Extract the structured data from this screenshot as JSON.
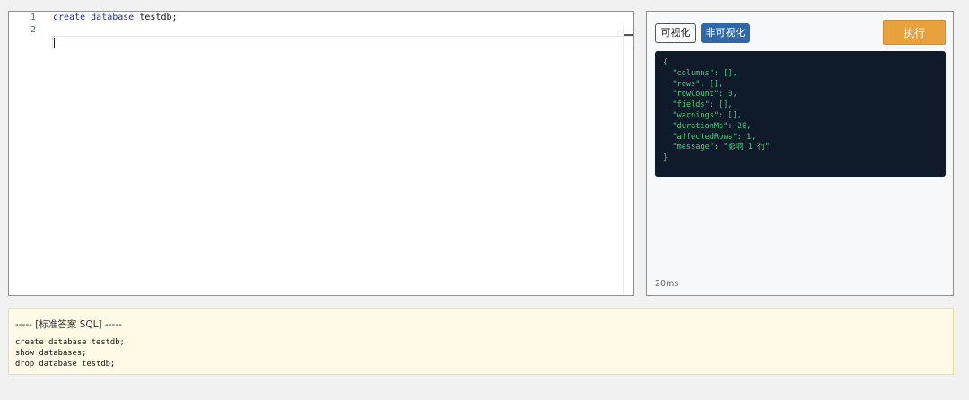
{
  "editor": {
    "lines": [
      {
        "number": "1",
        "keyword1": "create",
        "keyword2": "database",
        "rest": "testdb;"
      },
      {
        "number": "2",
        "text": ""
      }
    ]
  },
  "result": {
    "visual_label": "可视化",
    "nonvisual_label": "非可视化",
    "execute_label": "执行",
    "json_lines": [
      "{",
      "  \"columns\": [],",
      "  \"rows\": [],",
      "  \"rowCount\": 0,",
      "  \"fields\": [],",
      "  \"warnings\": [],",
      "  \"durationMs\": 20,",
      "  \"affectedRows\": 1,",
      "  \"message\": \"影响 1 行\"",
      "}"
    ],
    "duration": "20ms"
  },
  "answer": {
    "header": "----- [标准答案 SQL] -----",
    "lines": [
      "create database testdb;",
      "show databases;",
      "drop database testdb;"
    ]
  },
  "colors": {
    "execute_button": "#e9a13e",
    "nonvisual_button": "#2f67a8",
    "json_background": "#0f1b2a",
    "json_text": "#3fd07a",
    "answer_background": "#fefae6"
  }
}
